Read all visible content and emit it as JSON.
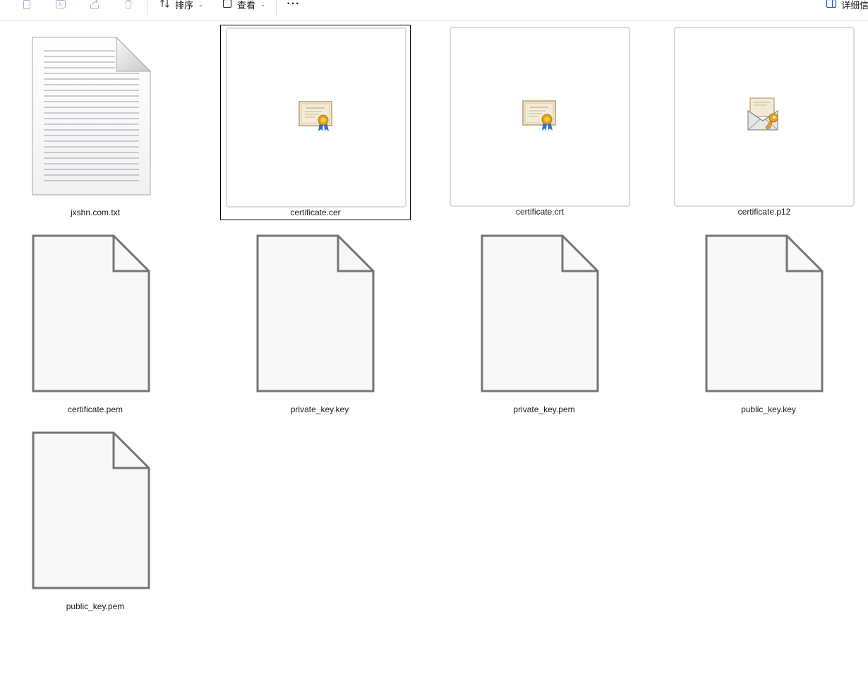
{
  "toolbar": {
    "icons": [
      "copy-icon",
      "rename-icon",
      "share-icon",
      "delete-icon"
    ],
    "sort_label": "排序",
    "view_label": "查看",
    "more_label": "···",
    "details_label": "详细信"
  },
  "files": [
    {
      "name": "jxshn.com.txt",
      "icon": "text-document-icon"
    },
    {
      "name": "certificate.cer",
      "icon": "certificate-icon",
      "selected": true
    },
    {
      "name": "certificate.crt",
      "icon": "certificate-icon"
    },
    {
      "name": "certificate.p12",
      "icon": "key-envelope-icon"
    },
    {
      "name": "certificate.pem",
      "icon": "blank-document-icon"
    },
    {
      "name": "private_key.key",
      "icon": "blank-document-icon"
    },
    {
      "name": "private_key.pem",
      "icon": "blank-document-icon"
    },
    {
      "name": "public_key.key",
      "icon": "blank-document-icon"
    },
    {
      "name": "public_key.pem",
      "icon": "blank-document-icon"
    }
  ]
}
